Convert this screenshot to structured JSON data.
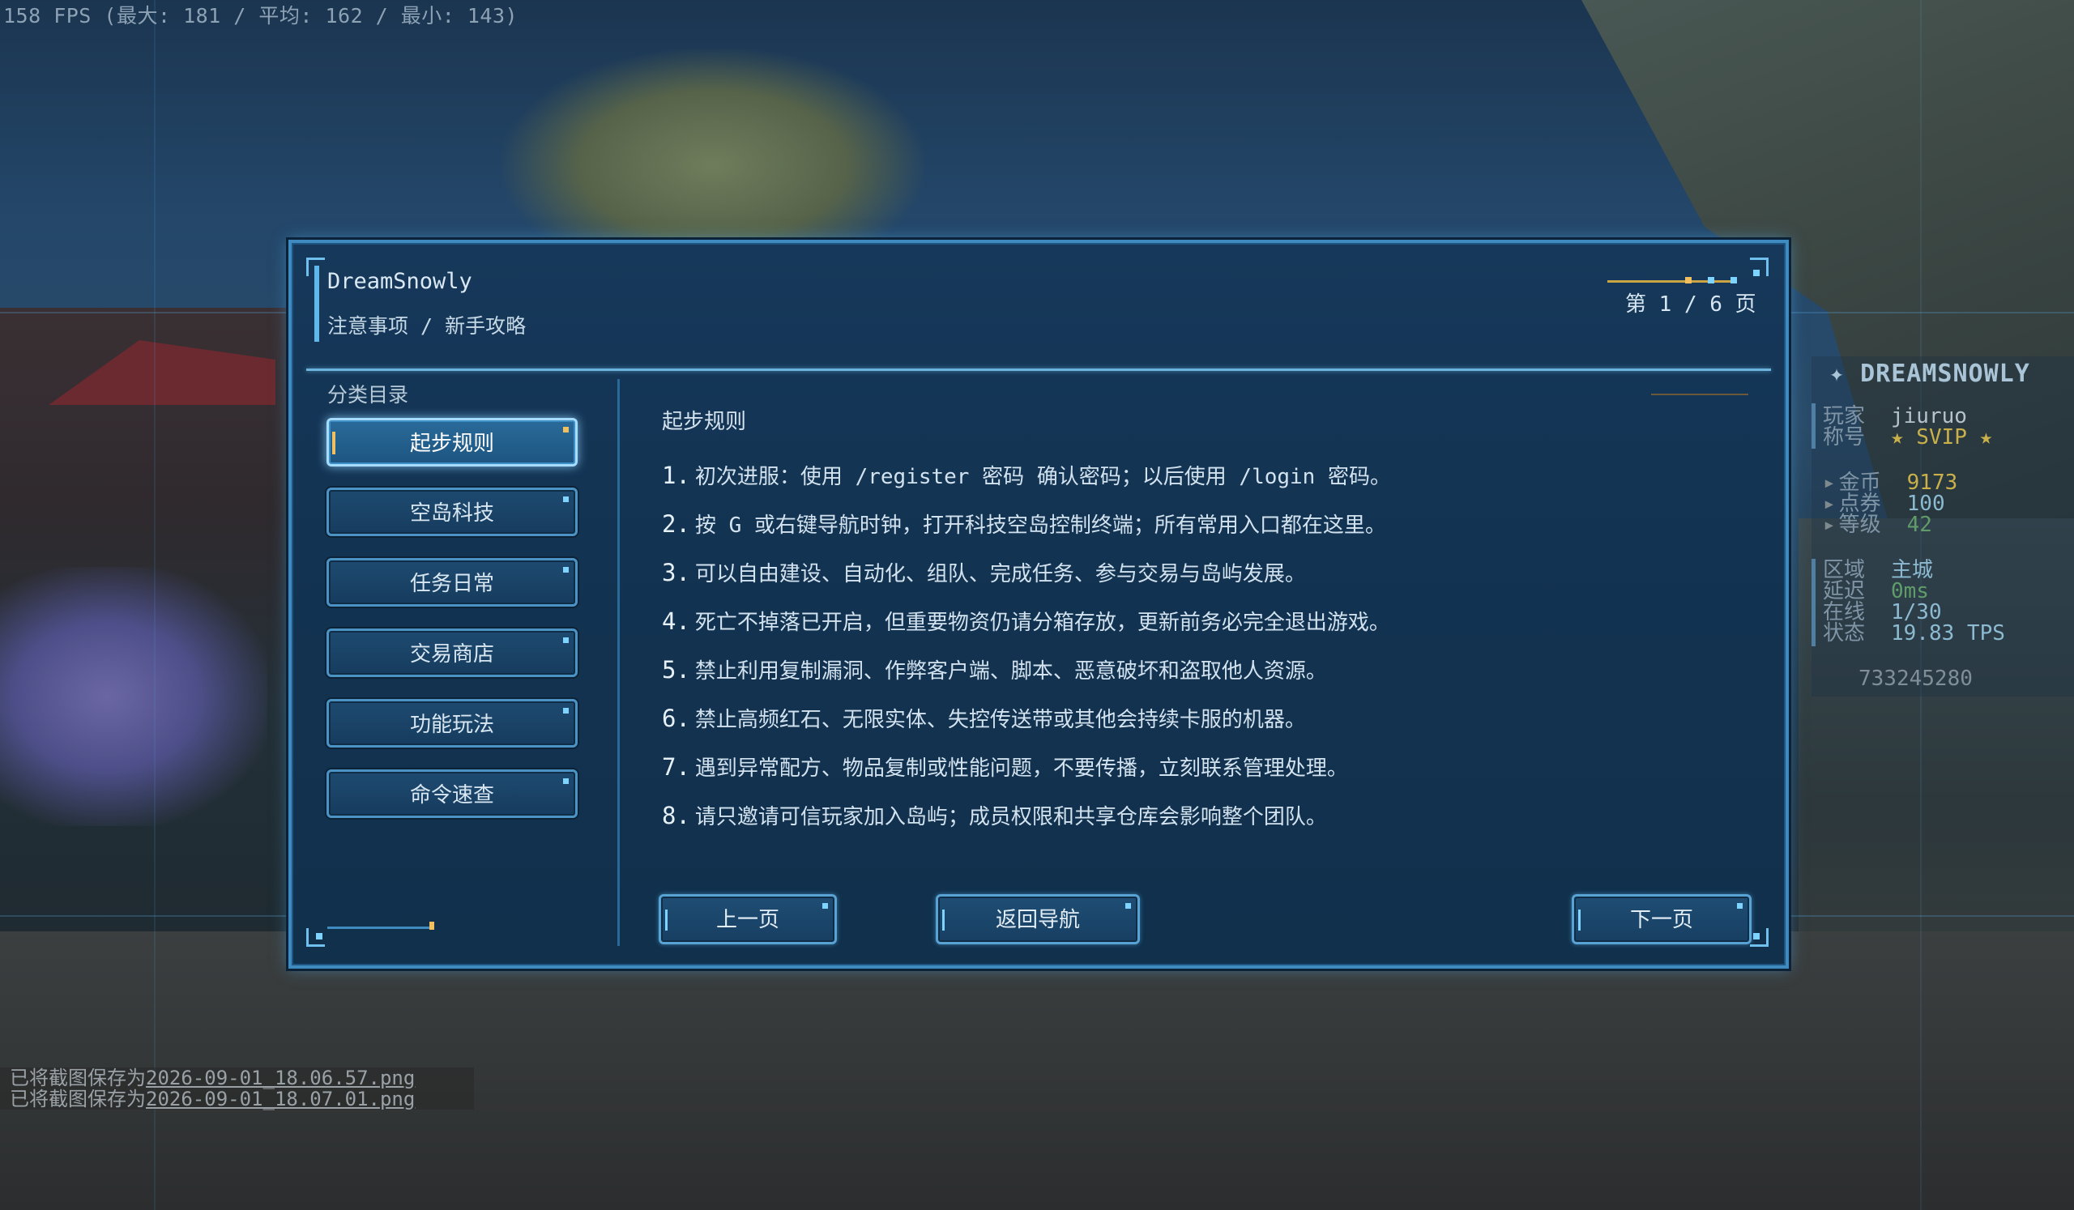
{
  "hud": {
    "fps": "158 FPS (最大: 181 / 平均: 162 / 最小: 143)"
  },
  "chat": {
    "lines": [
      {
        "prefix": "已将截图保存为",
        "file": "2026-09-01_18.06.57.png"
      },
      {
        "prefix": "已将截图保存为",
        "file": "2026-09-01_18.07.01.png"
      }
    ]
  },
  "scoreboard": {
    "title": "✦ DREAMSNOWLY",
    "player_label": "玩家",
    "player_value": "jiuruo",
    "rank_label": "称号",
    "rank_value": "★ SVIP ★",
    "coins_label": "金币",
    "coins_value": "9173",
    "points_label": "点券",
    "points_value": "100",
    "level_label": "等级",
    "level_value": "42",
    "area_label": "区域",
    "area_value": "主城",
    "latency_label": "延迟",
    "latency_value": "0ms",
    "online_label": "在线",
    "online_value": "1/30",
    "status_label": "状态",
    "status_value": "19.83 TPS",
    "footer": "733245280"
  },
  "panel": {
    "brand": "DreamSnowly",
    "breadcrumb": "注意事项 / 新手攻略",
    "page_indicator": "第 1 / 6 页",
    "category_title": "分类目录",
    "categories": [
      {
        "label": "起步规则",
        "active": true
      },
      {
        "label": "空岛科技",
        "active": false
      },
      {
        "label": "任务日常",
        "active": false
      },
      {
        "label": "交易商店",
        "active": false
      },
      {
        "label": "功能玩法",
        "active": false
      },
      {
        "label": "命令速查",
        "active": false
      }
    ],
    "section_title": "起步规则",
    "rules": [
      {
        "n": "1.",
        "text": "初次进服：使用 /register 密码 确认密码；以后使用 /login 密码。"
      },
      {
        "n": "2.",
        "text": "按 G 或右键导航时钟，打开科技空岛控制终端；所有常用入口都在这里。"
      },
      {
        "n": "3.",
        "text": "可以自由建设、自动化、组队、完成任务、参与交易与岛屿发展。"
      },
      {
        "n": "4.",
        "text": "死亡不掉落已开启，但重要物资仍请分箱存放，更新前务必完全退出游戏。"
      },
      {
        "n": "5.",
        "text": "禁止利用复制漏洞、作弊客户端、脚本、恶意破坏和盗取他人资源。"
      },
      {
        "n": "6.",
        "text": "禁止高频红石、无限实体、失控传送带或其他会持续卡服的机器。"
      },
      {
        "n": "7.",
        "text": "遇到异常配方、物品复制或性能问题，不要传播，立刻联系管理处理。"
      },
      {
        "n": "8.",
        "text": "请只邀请可信玩家加入岛屿；成员权限和共享仓库会影响整个团队。"
      }
    ],
    "buttons": {
      "prev": "上一页",
      "back": "返回导航",
      "next": "下一页"
    }
  },
  "colors": {
    "panel_bg": "#133352",
    "border": "#3f8bc0",
    "accent": "#6cb3de",
    "highlight": "#f0c060"
  }
}
